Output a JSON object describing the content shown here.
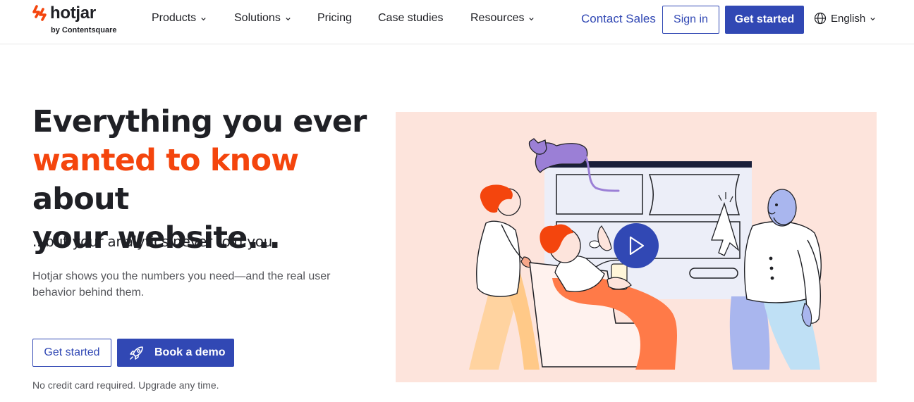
{
  "header": {
    "logo": {
      "wordmark": "hotjar",
      "byline": "by Contentsquare",
      "mark_icon": "hotjar-mark-icon"
    },
    "nav": [
      {
        "label": "Products",
        "has_dropdown": true
      },
      {
        "label": "Solutions",
        "has_dropdown": true
      },
      {
        "label": "Pricing",
        "has_dropdown": false
      },
      {
        "label": "Case studies",
        "has_dropdown": false
      },
      {
        "label": "Resources",
        "has_dropdown": true
      }
    ],
    "contact_label": "Contact Sales",
    "signin_label": "Sign in",
    "getstarted_label": "Get started",
    "language": {
      "label": "English",
      "icon": "globe-icon"
    }
  },
  "hero": {
    "title_line1": "Everything you ever",
    "title_accent": "wanted to know",
    "title_after_accent": " about",
    "title_line3": "your website...",
    "subtitle": "...but your analytics never told you.",
    "description": "Hotjar shows you the numbers you need—and the real user behavior behind them.",
    "cta_primary": "Get started",
    "cta_demo": "Book a demo",
    "cta_demo_icon": "rocket-icon",
    "note": "No credit card required. Upgrade any time."
  },
  "illustration": {
    "play_icon": "play-icon"
  },
  "colors": {
    "brand_blue": "#3148b4",
    "accent_orange": "#f4450d",
    "illustration_bg": "#fde4dc"
  }
}
